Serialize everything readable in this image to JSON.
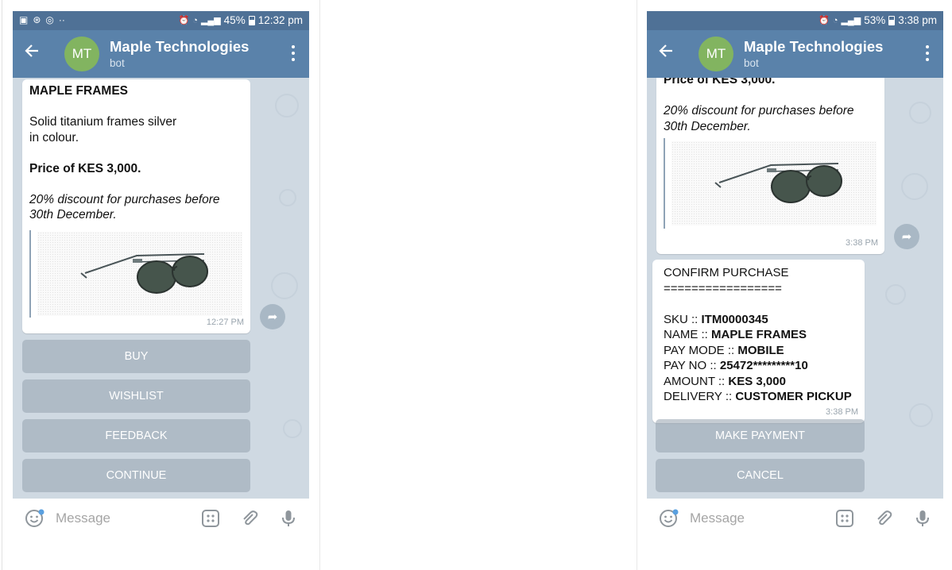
{
  "screens": [
    {
      "status": {
        "battery": "45%",
        "time": "12:32 pm"
      },
      "header": {
        "avatar": "MT",
        "title": "Maple Technologies",
        "subtitle": "bot"
      },
      "message": {
        "lines": [
          {
            "text": "MAPLE FRAMES",
            "style": "bold"
          },
          {
            "text": ""
          },
          {
            "text": "Solid titanium frames silver"
          },
          {
            "text": "in colour."
          },
          {
            "text": ""
          },
          {
            "text": "Price of KES 3,000.",
            "style": "bold"
          },
          {
            "text": ""
          },
          {
            "text": "20% discount for purchases before",
            "style": "italic"
          },
          {
            "text": "30th December.",
            "style": "italic"
          }
        ],
        "image": "sunglasses product image",
        "time": "12:27 PM"
      },
      "buttons": [
        "BUY",
        "WISHLIST",
        "FEEDBACK",
        "CONTINUE"
      ],
      "input": {
        "placeholder": "Message"
      }
    },
    {
      "status": {
        "battery": "53%",
        "time": "3:38 pm"
      },
      "header": {
        "avatar": "MT",
        "title": "Maple Technologies",
        "subtitle": "bot"
      },
      "message1": {
        "lines": [
          {
            "text": "Price of KES 3,000.",
            "style": "bold"
          },
          {
            "text": ""
          },
          {
            "text": "20% discount for purchases before",
            "style": "italic"
          },
          {
            "text": "30th December.",
            "style": "italic"
          }
        ],
        "time": "3:38 PM"
      },
      "message2": {
        "title": "CONFIRM  PURCHASE",
        "rule": "=================",
        "fields": [
          {
            "label": "SKU :: ",
            "value": "ITM0000345"
          },
          {
            "label": "NAME :: ",
            "value": "MAPLE FRAMES"
          },
          {
            "label": "PAY MODE :: ",
            "value": "MOBILE"
          },
          {
            "label": "PAY NO :: ",
            "value": "25472*********10"
          },
          {
            "label": "AMOUNT :: ",
            "value": "KES 3,000"
          },
          {
            "label": "DELIVERY  :: ",
            "value": "CUSTOMER PICKUP"
          }
        ],
        "time": "3:38 PM"
      },
      "buttons": [
        "MAKE PAYMENT",
        "CANCEL"
      ],
      "input": {
        "placeholder": "Message"
      }
    }
  ],
  "colors": {
    "statusbar": "#4f7196",
    "appbar": "#5a82aa",
    "avatar": "#82b460",
    "chat_bg": "#cfd9e2"
  }
}
